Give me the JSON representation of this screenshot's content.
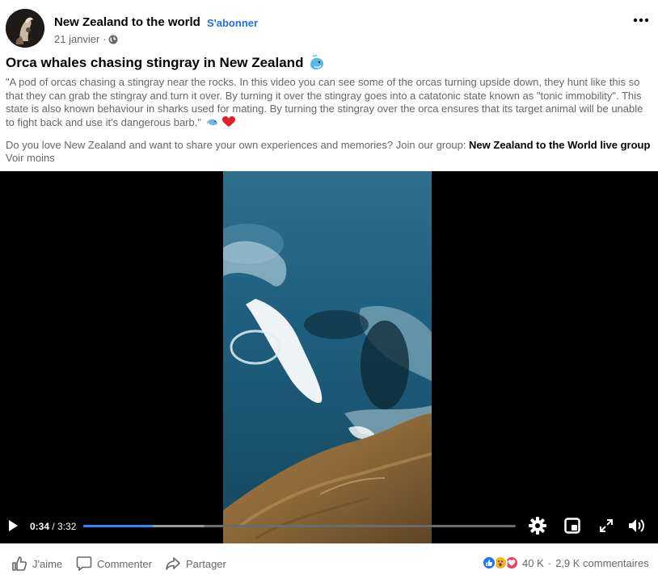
{
  "header": {
    "page_name": "New Zealand to the world",
    "separator": "·",
    "subscribe_label": "S'abonner",
    "date": "21 janvier ·"
  },
  "post": {
    "title": "Orca whales chasing stingray in New Zealand",
    "body": "\"A pod of orcas chasing a stingray near the rocks. In this video you can see some of the orcas turning upside down, they hunt like this so that they can grab the stingray and turn it over. By turning it over the stingray goes into a catatonic state known as \"tonic immobility\". This state is also known behaviour in sharks used for mating. By turning the stingray over the orca ensures that its target animal will be unable to fight back and use it's dangerous barb.\"",
    "cta_text": "Do you love New Zealand and want to share your own experiences and memories? Join our group: ",
    "cta_link": "New Zealand to the World live group",
    "see_less": "Voir moins"
  },
  "video": {
    "current_time": "0:34",
    "time_separator": " / ",
    "duration": "3:32",
    "progress_fraction": 0.16,
    "buffered_fraction": 0.28
  },
  "actions": {
    "like_label": "J'aime",
    "comment_label": "Commenter",
    "share_label": "Partager"
  },
  "stats": {
    "reactions_count": "40 K",
    "separator": "·",
    "comments_count": "2,9 K commentaires"
  },
  "colors": {
    "accent": "#216fdb",
    "progress": "#2d88ff",
    "like": "#1877f2",
    "love": "#f33e58",
    "wow": "#f7b125"
  },
  "icons": {
    "emoji_title": "whale-emoji",
    "emoji_body": "whale-and-red-heart-emoji"
  }
}
